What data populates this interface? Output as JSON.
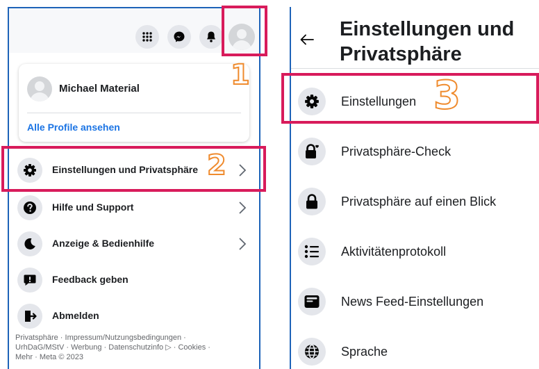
{
  "colors": {
    "accent": "#1b74e4",
    "frame": "#1d63b8",
    "highlight": "#d81b5b",
    "number": "#ef8b2e"
  },
  "left": {
    "topbar_icons": [
      "grid-icon",
      "messenger-icon",
      "bell-icon",
      "avatar-icon"
    ],
    "profile": {
      "name": "Michael Material",
      "see_all": "Alle Profile ansehen"
    },
    "menu": [
      {
        "label": "Einstellungen und Privatsphäre",
        "icon": "gear-icon"
      },
      {
        "label": "Hilfe und Support",
        "icon": "question-icon"
      },
      {
        "label": "Anzeige & Bedienhilfe",
        "icon": "moon-icon"
      },
      {
        "label": "Feedback geben",
        "icon": "feedback-icon"
      },
      {
        "label": "Abmelden",
        "icon": "logout-icon"
      }
    ],
    "footer": {
      "line1": "Privatsphäre · Impressum/Nutzungsbedingungen ·",
      "line2": "UrhDaG/MStV · Werbung · Datenschutzinfo ▷ · Cookies ·",
      "line3": "Mehr · Meta © 2023"
    }
  },
  "right": {
    "title": "Einstellungen und Privatsphäre",
    "items": [
      {
        "label": "Einstellungen",
        "icon": "gear-icon"
      },
      {
        "label": "Privatsphäre-Check",
        "icon": "lock-heart-icon"
      },
      {
        "label": "Privatsphäre auf einen Blick",
        "icon": "lock-icon"
      },
      {
        "label": "Aktivitätenprotokoll",
        "icon": "list-icon"
      },
      {
        "label": "News Feed-Einstellungen",
        "icon": "feed-icon"
      },
      {
        "label": "Sprache",
        "icon": "globe-icon"
      }
    ]
  },
  "annotations": {
    "step1": "1",
    "step2": "2",
    "step3": "3"
  }
}
